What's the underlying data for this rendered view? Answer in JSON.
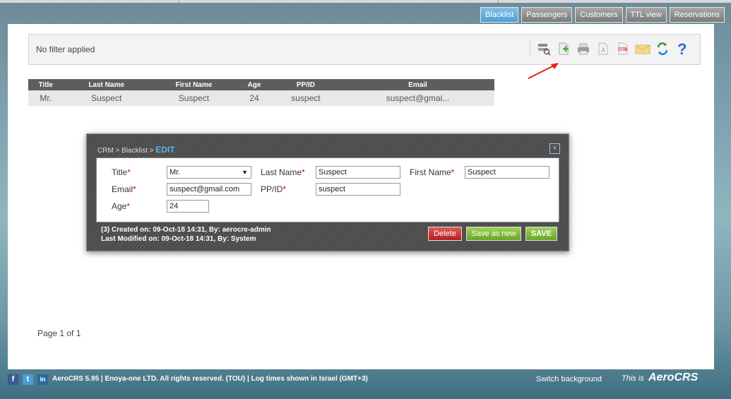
{
  "tabs": [
    {
      "label": "Blacklist",
      "active": true
    },
    {
      "label": "Passengers"
    },
    {
      "label": "Customers"
    },
    {
      "label": "TTL view"
    },
    {
      "label": "Reservations"
    }
  ],
  "filter": {
    "text": "No filter applied"
  },
  "toolbar_icons": [
    "filter-icon",
    "add-record-icon",
    "print-icon",
    "export-text-icon",
    "export-pdf-icon",
    "email-icon",
    "refresh-icon",
    "help-icon"
  ],
  "table": {
    "headers": [
      "Title",
      "Last Name",
      "First Name",
      "Age",
      "PP/ID",
      "Email"
    ],
    "rows": [
      [
        "Mr.",
        "Suspect",
        "Suspect",
        "24",
        "suspect",
        "suspect@gmai..."
      ]
    ]
  },
  "pagination": {
    "text": "Page 1 of 1"
  },
  "modal": {
    "breadcrumb": "CRM > Blacklist > ",
    "mode": "EDIT",
    "close": "×",
    "fields": {
      "title": {
        "label": "Title",
        "value": "Mr."
      },
      "last_name": {
        "label": "Last Name",
        "value": "Suspect"
      },
      "first_name": {
        "label": "First Name",
        "value": "Suspect"
      },
      "email": {
        "label": "Email",
        "value": "suspect@gmail.com"
      },
      "ppid": {
        "label": "PP/ID",
        "value": "suspect"
      },
      "age": {
        "label": "Age",
        "value": "24"
      }
    },
    "required_mark": "*",
    "created": "(3) Created on: 09-Oct-18 14:31, By: aerocre-admin",
    "modified": "Last Modified on: 09-Oct-18 14:31, By: System",
    "buttons": {
      "delete": "Delete",
      "save_as_new": "Save as new",
      "save": "SAVE"
    }
  },
  "footer": {
    "social": [
      "f",
      "t",
      "in"
    ],
    "text": "AeroCRS 5.95  | Enoya-one LTD. All rights reserved. (TOU)  | Log times shown in Israel (GMT+3)",
    "switch_background": "Switch background",
    "this_is": "This is",
    "logo": "AeroCRS"
  },
  "colors": {
    "accent": "#4a9fd2",
    "delete": "#b21f1f",
    "save": "#6aa424"
  }
}
